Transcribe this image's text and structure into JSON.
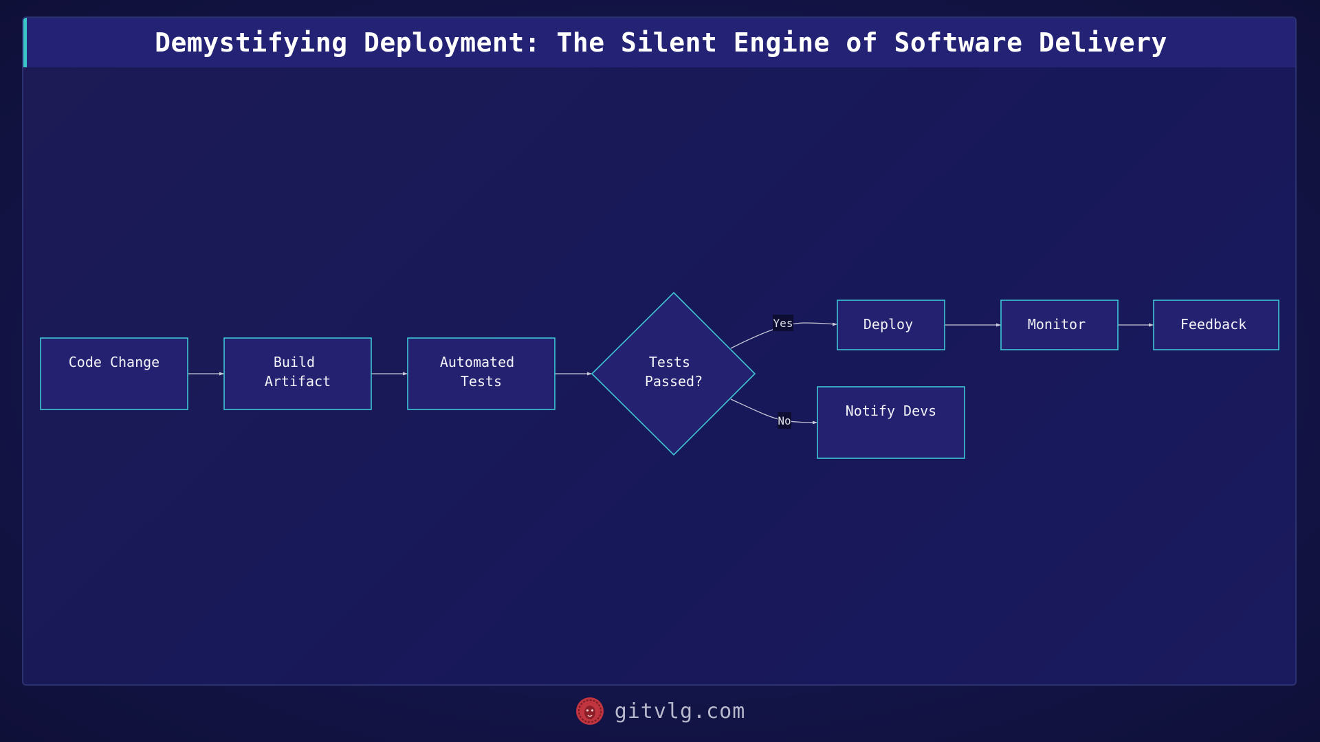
{
  "header": {
    "title": "Demystifying Deployment: The Silent Engine of Software Delivery"
  },
  "diagram": {
    "nodes": {
      "code_change": "Code Change",
      "build_artifact_line1": "Build",
      "build_artifact_line2": "Artifact",
      "automated_tests_line1": "Automated",
      "automated_tests_line2": "Tests",
      "tests_passed_line1": "Tests",
      "tests_passed_line2": "Passed?",
      "deploy": "Deploy",
      "monitor": "Monitor",
      "feedback": "Feedback",
      "notify_devs": "Notify Devs"
    },
    "edges": {
      "yes_label": "Yes",
      "no_label": "No"
    }
  },
  "footer": {
    "site": "gitvlg.com",
    "logo_icon": "lion-head-icon"
  },
  "colors": {
    "background": "#14154a",
    "node_fill": "#232170",
    "node_stroke": "#3fc6d6",
    "accent": "#3cc6c8",
    "logo": "#c0353f"
  }
}
